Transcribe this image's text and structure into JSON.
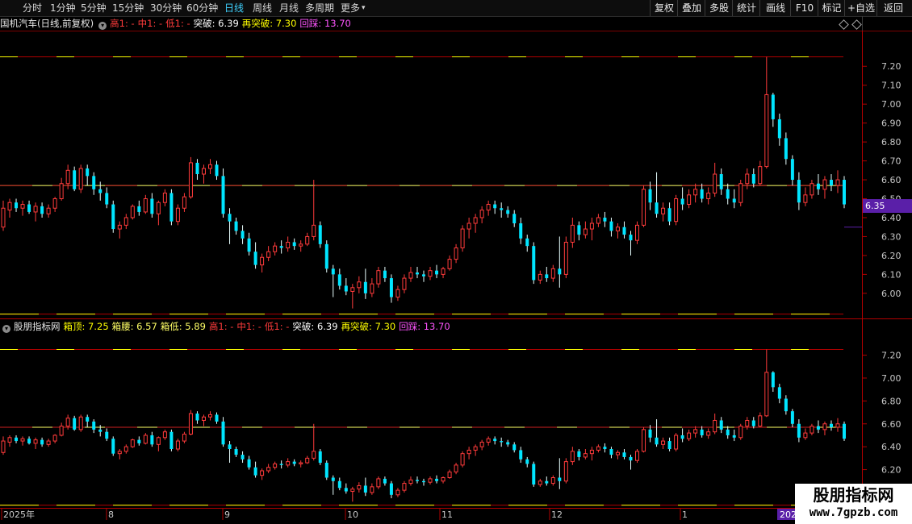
{
  "toolbar": {
    "periods": [
      "分时",
      "1分钟",
      "5分钟",
      "15分钟",
      "30分钟",
      "60分钟",
      "日线",
      "周线",
      "月线",
      "多周期",
      "更多"
    ],
    "active_period": "日线",
    "right_buttons": [
      "复权",
      "叠加",
      "多股",
      "统计",
      "画线",
      "F10",
      "标记",
      "+自选",
      "返回"
    ]
  },
  "main_panel": {
    "stock_title": "国机汽车(日线,前复权)",
    "gao": "高1: -",
    "zhong": "中1: -",
    "di": "低1: -",
    "tupo": "突破: 6.39",
    "zai_tupo": "再突破: 7.30",
    "huicai": "回踩: 13.70",
    "y_ticks": [
      "7.20",
      "7.10",
      "7.00",
      "6.90",
      "6.80",
      "6.70",
      "6.60",
      "6.50",
      "6.40",
      "6.30",
      "6.20",
      "6.10",
      "6.00"
    ],
    "current_price": "6.35"
  },
  "indicator_panel": {
    "name": "股朋指标网",
    "xiangding": "箱顶: 7.25",
    "xiangyao": "箱腰: 6.57",
    "xiangdi": "箱低: 5.89",
    "gao": "高1: -",
    "zhong": "中1: -",
    "di": "低1: -",
    "tupo": "突破: 6.39",
    "zai_tupo": "再突破: 7.30",
    "huicai": "回踩: 13.70",
    "y_ticks": [
      "7.20",
      "7.00",
      "6.80",
      "6.60",
      "6.40",
      "6.20"
    ]
  },
  "x_axis": {
    "labels": [
      "2025年",
      "8",
      "9",
      "10",
      "11",
      "12",
      "1",
      "202"
    ]
  },
  "watermark": {
    "line1": "股朋指标网",
    "line2": "www.7gpzb.com"
  },
  "colors": {
    "up": "#ff3b3b",
    "down": "#00e5ff",
    "box_top": "#ffff00",
    "box_mid": "#ffff66",
    "huicai": "#ff55ff",
    "grid_red": "#7a0000"
  },
  "chart_data": {
    "type": "candlestick",
    "box_top": 7.25,
    "box_mid": 6.57,
    "box_low": 5.89,
    "y_range_main": [
      5.88,
      7.38
    ],
    "y_range_indicator": [
      5.88,
      7.38
    ],
    "candles": [
      {
        "o": 6.35,
        "h": 6.49,
        "l": 6.33,
        "c": 6.45
      },
      {
        "o": 6.44,
        "h": 6.5,
        "l": 6.4,
        "c": 6.48
      },
      {
        "o": 6.48,
        "h": 6.5,
        "l": 6.43,
        "c": 6.45
      },
      {
        "o": 6.45,
        "h": 6.49,
        "l": 6.41,
        "c": 6.47
      },
      {
        "o": 6.47,
        "h": 6.49,
        "l": 6.42,
        "c": 6.43
      },
      {
        "o": 6.43,
        "h": 6.48,
        "l": 6.38,
        "c": 6.46
      },
      {
        "o": 6.46,
        "h": 6.48,
        "l": 6.4,
        "c": 6.42
      },
      {
        "o": 6.42,
        "h": 6.47,
        "l": 6.4,
        "c": 6.45
      },
      {
        "o": 6.45,
        "h": 6.51,
        "l": 6.43,
        "c": 6.5
      },
      {
        "o": 6.5,
        "h": 6.61,
        "l": 6.49,
        "c": 6.58
      },
      {
        "o": 6.58,
        "h": 6.68,
        "l": 6.55,
        "c": 6.65
      },
      {
        "o": 6.65,
        "h": 6.67,
        "l": 6.54,
        "c": 6.55
      },
      {
        "o": 6.55,
        "h": 6.68,
        "l": 6.53,
        "c": 6.66
      },
      {
        "o": 6.66,
        "h": 6.68,
        "l": 6.57,
        "c": 6.62
      },
      {
        "o": 6.62,
        "h": 6.64,
        "l": 6.52,
        "c": 6.55
      },
      {
        "o": 6.55,
        "h": 6.59,
        "l": 6.49,
        "c": 6.53
      },
      {
        "o": 6.53,
        "h": 6.56,
        "l": 6.45,
        "c": 6.47
      },
      {
        "o": 6.47,
        "h": 6.49,
        "l": 6.32,
        "c": 6.34
      },
      {
        "o": 6.34,
        "h": 6.38,
        "l": 6.29,
        "c": 6.36
      },
      {
        "o": 6.36,
        "h": 6.42,
        "l": 6.34,
        "c": 6.4
      },
      {
        "o": 6.4,
        "h": 6.47,
        "l": 6.39,
        "c": 6.46
      },
      {
        "o": 6.46,
        "h": 6.49,
        "l": 6.41,
        "c": 6.43
      },
      {
        "o": 6.43,
        "h": 6.52,
        "l": 6.42,
        "c": 6.5
      },
      {
        "o": 6.5,
        "h": 6.53,
        "l": 6.4,
        "c": 6.42
      },
      {
        "o": 6.42,
        "h": 6.49,
        "l": 6.36,
        "c": 6.48
      },
      {
        "o": 6.48,
        "h": 6.55,
        "l": 6.46,
        "c": 6.53
      },
      {
        "o": 6.53,
        "h": 6.55,
        "l": 6.36,
        "c": 6.38
      },
      {
        "o": 6.38,
        "h": 6.47,
        "l": 6.36,
        "c": 6.45
      },
      {
        "o": 6.45,
        "h": 6.53,
        "l": 6.43,
        "c": 6.51
      },
      {
        "o": 6.51,
        "h": 6.72,
        "l": 6.5,
        "c": 6.69
      },
      {
        "o": 6.69,
        "h": 6.71,
        "l": 6.6,
        "c": 6.63
      },
      {
        "o": 6.63,
        "h": 6.68,
        "l": 6.58,
        "c": 6.66
      },
      {
        "o": 6.66,
        "h": 6.71,
        "l": 6.63,
        "c": 6.68
      },
      {
        "o": 6.68,
        "h": 6.7,
        "l": 6.6,
        "c": 6.62
      },
      {
        "o": 6.62,
        "h": 6.66,
        "l": 6.4,
        "c": 6.42
      },
      {
        "o": 6.42,
        "h": 6.45,
        "l": 6.26,
        "c": 6.38
      },
      {
        "o": 6.38,
        "h": 6.4,
        "l": 6.31,
        "c": 6.33
      },
      {
        "o": 6.33,
        "h": 6.36,
        "l": 6.26,
        "c": 6.29
      },
      {
        "o": 6.29,
        "h": 6.32,
        "l": 6.2,
        "c": 6.22
      },
      {
        "o": 6.22,
        "h": 6.27,
        "l": 6.13,
        "c": 6.15
      },
      {
        "o": 6.15,
        "h": 6.21,
        "l": 6.11,
        "c": 6.19
      },
      {
        "o": 6.19,
        "h": 6.25,
        "l": 6.17,
        "c": 6.22
      },
      {
        "o": 6.22,
        "h": 6.27,
        "l": 6.2,
        "c": 6.25
      },
      {
        "o": 6.25,
        "h": 6.28,
        "l": 6.21,
        "c": 6.24
      },
      {
        "o": 6.24,
        "h": 6.3,
        "l": 6.22,
        "c": 6.27
      },
      {
        "o": 6.27,
        "h": 6.29,
        "l": 6.23,
        "c": 6.25
      },
      {
        "o": 6.25,
        "h": 6.28,
        "l": 6.22,
        "c": 6.26
      },
      {
        "o": 6.26,
        "h": 6.32,
        "l": 6.25,
        "c": 6.3
      },
      {
        "o": 6.3,
        "h": 6.6,
        "l": 6.28,
        "c": 6.36
      },
      {
        "o": 6.36,
        "h": 6.38,
        "l": 6.24,
        "c": 6.26
      },
      {
        "o": 6.26,
        "h": 6.28,
        "l": 6.11,
        "c": 6.13
      },
      {
        "o": 6.13,
        "h": 6.15,
        "l": 5.98,
        "c": 6.1
      },
      {
        "o": 6.1,
        "h": 6.13,
        "l": 6.02,
        "c": 6.04
      },
      {
        "o": 6.04,
        "h": 6.08,
        "l": 5.99,
        "c": 6.01
      },
      {
        "o": 6.01,
        "h": 6.05,
        "l": 5.92,
        "c": 6.03
      },
      {
        "o": 6.03,
        "h": 6.09,
        "l": 6.0,
        "c": 6.06
      },
      {
        "o": 6.06,
        "h": 6.13,
        "l": 5.97,
        "c": 6.0
      },
      {
        "o": 6.0,
        "h": 6.08,
        "l": 5.98,
        "c": 6.05
      },
      {
        "o": 6.05,
        "h": 6.14,
        "l": 6.03,
        "c": 6.12
      },
      {
        "o": 6.12,
        "h": 6.14,
        "l": 6.06,
        "c": 6.08
      },
      {
        "o": 6.08,
        "h": 6.1,
        "l": 5.95,
        "c": 5.98
      },
      {
        "o": 5.98,
        "h": 6.04,
        "l": 5.96,
        "c": 6.02
      },
      {
        "o": 6.02,
        "h": 6.1,
        "l": 6.0,
        "c": 6.08
      },
      {
        "o": 6.08,
        "h": 6.14,
        "l": 6.06,
        "c": 6.11
      },
      {
        "o": 6.11,
        "h": 6.14,
        "l": 6.08,
        "c": 6.1
      },
      {
        "o": 6.1,
        "h": 6.12,
        "l": 6.06,
        "c": 6.09
      },
      {
        "o": 6.09,
        "h": 6.14,
        "l": 6.07,
        "c": 6.12
      },
      {
        "o": 6.12,
        "h": 6.15,
        "l": 6.08,
        "c": 6.1
      },
      {
        "o": 6.1,
        "h": 6.14,
        "l": 6.08,
        "c": 6.13
      },
      {
        "o": 6.13,
        "h": 6.2,
        "l": 6.12,
        "c": 6.18
      },
      {
        "o": 6.18,
        "h": 6.26,
        "l": 6.16,
        "c": 6.24
      },
      {
        "o": 6.24,
        "h": 6.36,
        "l": 6.22,
        "c": 6.34
      },
      {
        "o": 6.34,
        "h": 6.4,
        "l": 6.29,
        "c": 6.37
      },
      {
        "o": 6.37,
        "h": 6.42,
        "l": 6.32,
        "c": 6.4
      },
      {
        "o": 6.4,
        "h": 6.46,
        "l": 6.37,
        "c": 6.44
      },
      {
        "o": 6.44,
        "h": 6.49,
        "l": 6.41,
        "c": 6.47
      },
      {
        "o": 6.47,
        "h": 6.49,
        "l": 6.42,
        "c": 6.45
      },
      {
        "o": 6.45,
        "h": 6.48,
        "l": 6.4,
        "c": 6.44
      },
      {
        "o": 6.44,
        "h": 6.46,
        "l": 6.4,
        "c": 6.42
      },
      {
        "o": 6.42,
        "h": 6.44,
        "l": 6.35,
        "c": 6.37
      },
      {
        "o": 6.37,
        "h": 6.4,
        "l": 6.26,
        "c": 6.29
      },
      {
        "o": 6.29,
        "h": 6.31,
        "l": 6.22,
        "c": 6.25
      },
      {
        "o": 6.25,
        "h": 6.27,
        "l": 6.05,
        "c": 6.07
      },
      {
        "o": 6.07,
        "h": 6.12,
        "l": 6.05,
        "c": 6.1
      },
      {
        "o": 6.1,
        "h": 6.14,
        "l": 6.06,
        "c": 6.08
      },
      {
        "o": 6.08,
        "h": 6.15,
        "l": 6.06,
        "c": 6.13
      },
      {
        "o": 6.13,
        "h": 6.3,
        "l": 6.03,
        "c": 6.1
      },
      {
        "o": 6.1,
        "h": 6.3,
        "l": 6.08,
        "c": 6.27
      },
      {
        "o": 6.27,
        "h": 6.4,
        "l": 6.24,
        "c": 6.36
      },
      {
        "o": 6.36,
        "h": 6.38,
        "l": 6.28,
        "c": 6.31
      },
      {
        "o": 6.31,
        "h": 6.38,
        "l": 6.29,
        "c": 6.34
      },
      {
        "o": 6.34,
        "h": 6.4,
        "l": 6.28,
        "c": 6.37
      },
      {
        "o": 6.37,
        "h": 6.42,
        "l": 6.35,
        "c": 6.4
      },
      {
        "o": 6.4,
        "h": 6.43,
        "l": 6.35,
        "c": 6.38
      },
      {
        "o": 6.38,
        "h": 6.4,
        "l": 6.3,
        "c": 6.33
      },
      {
        "o": 6.33,
        "h": 6.37,
        "l": 6.29,
        "c": 6.35
      },
      {
        "o": 6.35,
        "h": 6.38,
        "l": 6.29,
        "c": 6.31
      },
      {
        "o": 6.31,
        "h": 6.33,
        "l": 6.2,
        "c": 6.28
      },
      {
        "o": 6.28,
        "h": 6.38,
        "l": 6.26,
        "c": 6.36
      },
      {
        "o": 6.36,
        "h": 6.57,
        "l": 6.35,
        "c": 6.55
      },
      {
        "o": 6.55,
        "h": 6.59,
        "l": 6.44,
        "c": 6.48
      },
      {
        "o": 6.48,
        "h": 6.64,
        "l": 6.4,
        "c": 6.42
      },
      {
        "o": 6.42,
        "h": 6.48,
        "l": 6.38,
        "c": 6.45
      },
      {
        "o": 6.45,
        "h": 6.48,
        "l": 6.36,
        "c": 6.38
      },
      {
        "o": 6.38,
        "h": 6.52,
        "l": 6.36,
        "c": 6.5
      },
      {
        "o": 6.5,
        "h": 6.56,
        "l": 6.44,
        "c": 6.47
      },
      {
        "o": 6.47,
        "h": 6.55,
        "l": 6.45,
        "c": 6.52
      },
      {
        "o": 6.52,
        "h": 6.58,
        "l": 6.48,
        "c": 6.55
      },
      {
        "o": 6.55,
        "h": 6.58,
        "l": 6.48,
        "c": 6.5
      },
      {
        "o": 6.5,
        "h": 6.56,
        "l": 6.47,
        "c": 6.53
      },
      {
        "o": 6.53,
        "h": 6.69,
        "l": 6.51,
        "c": 6.63
      },
      {
        "o": 6.63,
        "h": 6.66,
        "l": 6.52,
        "c": 6.55
      },
      {
        "o": 6.55,
        "h": 6.58,
        "l": 6.47,
        "c": 6.5
      },
      {
        "o": 6.5,
        "h": 6.55,
        "l": 6.45,
        "c": 6.48
      },
      {
        "o": 6.48,
        "h": 6.6,
        "l": 6.46,
        "c": 6.58
      },
      {
        "o": 6.58,
        "h": 6.66,
        "l": 6.55,
        "c": 6.63
      },
      {
        "o": 6.63,
        "h": 6.66,
        "l": 6.56,
        "c": 6.58
      },
      {
        "o": 6.58,
        "h": 6.7,
        "l": 6.57,
        "c": 6.67
      },
      {
        "o": 6.67,
        "h": 7.25,
        "l": 6.66,
        "c": 7.05
      },
      {
        "o": 7.05,
        "h": 7.06,
        "l": 6.88,
        "c": 6.92
      },
      {
        "o": 6.92,
        "h": 6.95,
        "l": 6.78,
        "c": 6.82
      },
      {
        "o": 6.82,
        "h": 6.85,
        "l": 6.68,
        "c": 6.71
      },
      {
        "o": 6.71,
        "h": 6.73,
        "l": 6.57,
        "c": 6.6
      },
      {
        "o": 6.6,
        "h": 6.64,
        "l": 6.44,
        "c": 6.48
      },
      {
        "o": 6.48,
        "h": 6.56,
        "l": 6.46,
        "c": 6.52
      },
      {
        "o": 6.52,
        "h": 6.6,
        "l": 6.5,
        "c": 6.58
      },
      {
        "o": 6.58,
        "h": 6.63,
        "l": 6.52,
        "c": 6.55
      },
      {
        "o": 6.55,
        "h": 6.62,
        "l": 6.5,
        "c": 6.6
      },
      {
        "o": 6.6,
        "h": 6.63,
        "l": 6.54,
        "c": 6.57
      },
      {
        "o": 6.57,
        "h": 6.65,
        "l": 6.53,
        "c": 6.6
      },
      {
        "o": 6.6,
        "h": 6.62,
        "l": 6.45,
        "c": 6.47
      }
    ]
  }
}
